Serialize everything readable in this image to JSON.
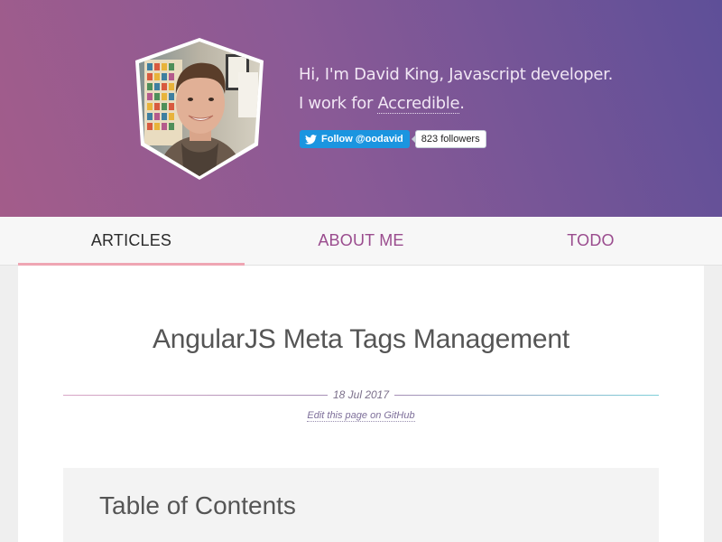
{
  "header": {
    "line1": "Hi, I'm David King, Javascript developer.",
    "line2_prefix": "I work for ",
    "line2_link": "Accredible",
    "line2_suffix": ".",
    "follow_label": "Follow @oodavid",
    "followers": "823 followers",
    "colors": {
      "gradient_start": "#a35c8a",
      "gradient_end": "#5e4f98",
      "twitter_blue": "#1b95e0"
    }
  },
  "nav": {
    "items": [
      {
        "label": "ARTICLES",
        "active": true
      },
      {
        "label": "ABOUT ME",
        "active": false
      },
      {
        "label": "TODO",
        "active": false
      }
    ],
    "accent": "#efa6b3"
  },
  "article": {
    "title": "AngularJS Meta Tags Management",
    "date": "18 Jul 2017",
    "edit_link": "Edit this page on GitHub"
  },
  "toc": {
    "title": "Table of Contents"
  }
}
